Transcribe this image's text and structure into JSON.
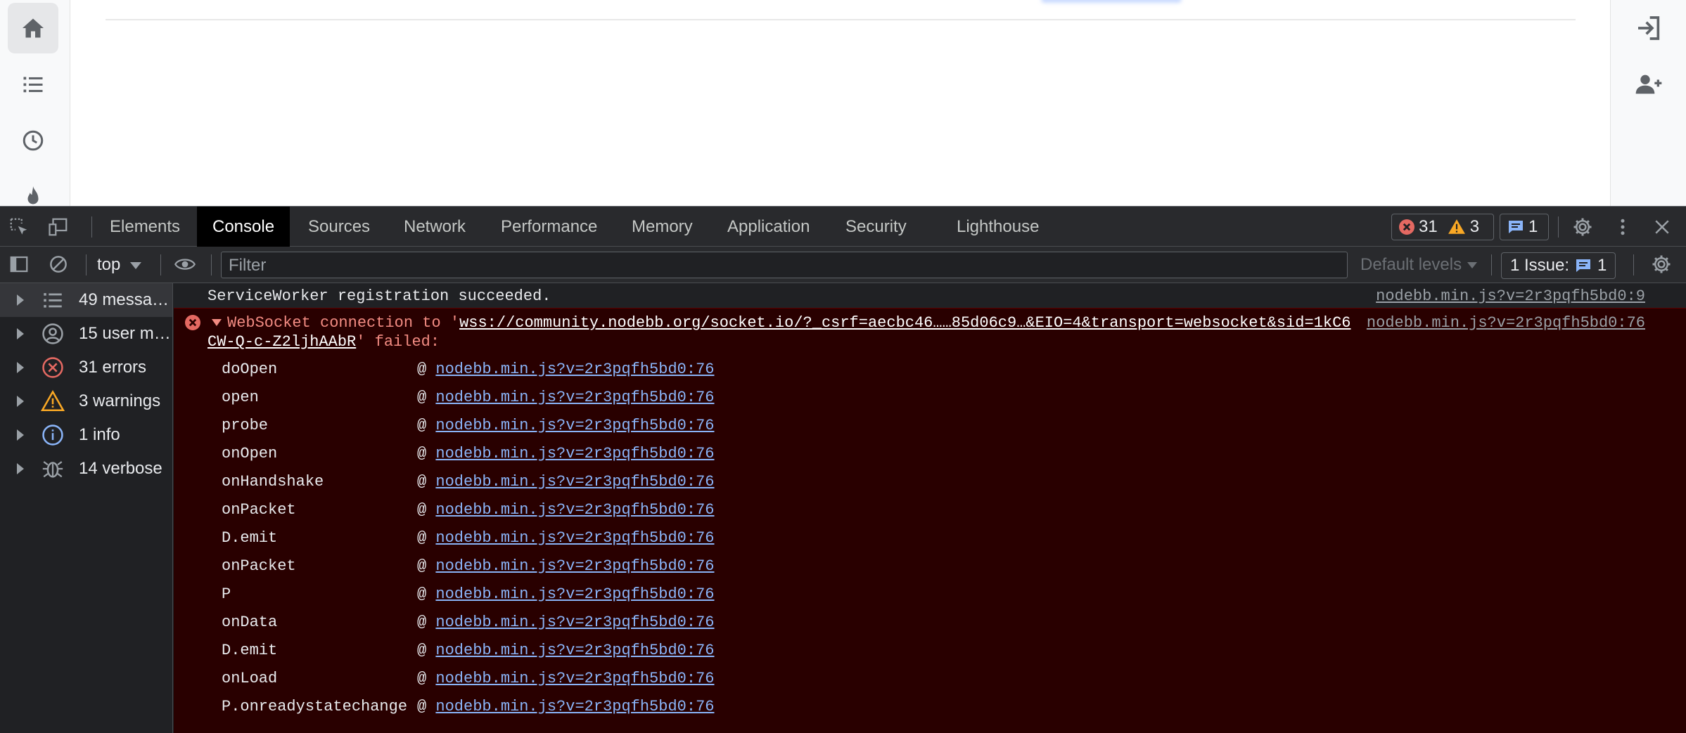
{
  "devtools": {
    "tabs": [
      "Elements",
      "Console",
      "Sources",
      "Network",
      "Performance",
      "Memory",
      "Application",
      "Security",
      "Lighthouse"
    ],
    "active_tab": "Console",
    "error_count": "31",
    "warning_count": "3",
    "info_count": "1"
  },
  "toolbar": {
    "context": "top",
    "filter_placeholder": "Filter",
    "levels": "Default levels",
    "issues_label": "1 Issue:",
    "issues_count": "1"
  },
  "sidebar": {
    "items": [
      {
        "label": "49 messa…",
        "icon": "list-icon"
      },
      {
        "label": "15 user m…",
        "icon": "user-icon"
      },
      {
        "label": "31 errors",
        "icon": "error-icon"
      },
      {
        "label": "3 warnings",
        "icon": "warning-icon"
      },
      {
        "label": "1 info",
        "icon": "info-icon"
      },
      {
        "label": "14 verbose",
        "icon": "bug-icon"
      }
    ]
  },
  "console": {
    "info_message": "ServiceWorker registration succeeded.",
    "info_source": "nodebb.min.js?v=2r3pqfh5bd0:9",
    "error_prefix": "WebSocket connection to '",
    "error_url_part1": "wss://community.nodebb.org/socket.io/?_csrf=aecbc46……85d06c9…&EIO=4&transport=websocket&sid=1kC6",
    "error_url_part2": "CW-Q-c-Z2ljhAAbR",
    "error_suffix": "' failed:",
    "error_source": "nodebb.min.js?v=2r3pqfh5bd0:76",
    "stack": [
      {
        "fn": "doOpen",
        "link": "nodebb.min.js?v=2r3pqfh5bd0:76"
      },
      {
        "fn": "open",
        "link": "nodebb.min.js?v=2r3pqfh5bd0:76"
      },
      {
        "fn": "probe",
        "link": "nodebb.min.js?v=2r3pqfh5bd0:76"
      },
      {
        "fn": "onOpen",
        "link": "nodebb.min.js?v=2r3pqfh5bd0:76"
      },
      {
        "fn": "onHandshake",
        "link": "nodebb.min.js?v=2r3pqfh5bd0:76"
      },
      {
        "fn": "onPacket",
        "link": "nodebb.min.js?v=2r3pqfh5bd0:76"
      },
      {
        "fn": "D.emit",
        "link": "nodebb.min.js?v=2r3pqfh5bd0:76"
      },
      {
        "fn": "onPacket",
        "link": "nodebb.min.js?v=2r3pqfh5bd0:76"
      },
      {
        "fn": "P",
        "link": "nodebb.min.js?v=2r3pqfh5bd0:76"
      },
      {
        "fn": "onData",
        "link": "nodebb.min.js?v=2r3pqfh5bd0:76"
      },
      {
        "fn": "D.emit",
        "link": "nodebb.min.js?v=2r3pqfh5bd0:76"
      },
      {
        "fn": "onLoad",
        "link": "nodebb.min.js?v=2r3pqfh5bd0:76"
      },
      {
        "fn": "P.onreadystatechange",
        "link": "nodebb.min.js?v=2r3pqfh5bd0:76"
      }
    ]
  },
  "colors": {
    "error_bg": "#290000",
    "error_text": "#f28b82",
    "link": "#8ab4f8",
    "devtools_bg": "#202124"
  }
}
